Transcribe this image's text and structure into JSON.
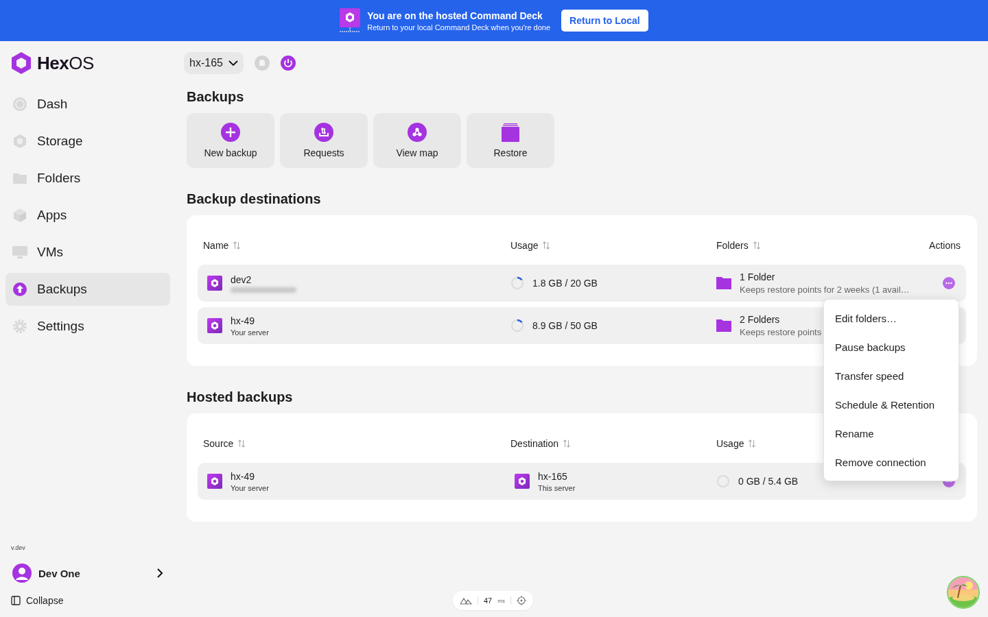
{
  "banner": {
    "title": "You are on the hosted Command Deck",
    "subtitle": "Return to your local Command Deck when you're done",
    "button": "Return to Local"
  },
  "sidebar": {
    "logo": {
      "bold": "Hex",
      "light": "OS"
    },
    "items": [
      {
        "label": "Dash",
        "selected": false
      },
      {
        "label": "Storage",
        "selected": false
      },
      {
        "label": "Folders",
        "selected": false
      },
      {
        "label": "Apps",
        "selected": false
      },
      {
        "label": "VMs",
        "selected": false
      },
      {
        "label": "Backups",
        "selected": true
      },
      {
        "label": "Settings",
        "selected": false
      }
    ],
    "version": "v.dev",
    "user": "Dev One",
    "collapse": "Collapse"
  },
  "server_selector": "hx-165",
  "page_title": "Backups",
  "actions": [
    {
      "label": "New backup"
    },
    {
      "label": "Requests"
    },
    {
      "label": "View map"
    },
    {
      "label": "Restore"
    }
  ],
  "destinations": {
    "title": "Backup destinations",
    "columns": [
      "Name",
      "Usage",
      "Folders",
      "Actions"
    ],
    "rows": [
      {
        "name": "dev2",
        "usage": "1.8 GB / 20 GB",
        "active": true,
        "folders": "1 Folder",
        "retention": "Keeps restore points for 2 weeks (1 avail…"
      },
      {
        "name": "hx-49",
        "subtitle": "Your server",
        "usage": "8.9 GB / 50 GB",
        "active": true,
        "folders": "2 Folders",
        "retention": "Keeps restore points"
      }
    ]
  },
  "hosted": {
    "title": "Hosted backups",
    "columns": [
      "Source",
      "Destination",
      "Usage"
    ],
    "rows": [
      {
        "source": "hx-49",
        "source_sub": "Your server",
        "destination": "hx-165",
        "destination_sub": "This server",
        "usage": "0 GB / 5.4 GB",
        "active": false
      }
    ]
  },
  "menu": {
    "items": [
      "Edit folders…",
      "Pause backups",
      "Transfer speed",
      "Schedule & Retention",
      "Rename",
      "Remove connection"
    ]
  },
  "status": {
    "latency": "47",
    "unit": "ms"
  }
}
